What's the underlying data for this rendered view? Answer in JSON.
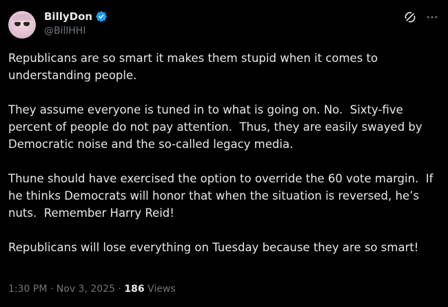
{
  "author": {
    "display_name": "BillyDon",
    "handle": "@BillHHI",
    "verified": true
  },
  "icons": {
    "verified": "verified-badge-icon",
    "grok": "grok-icon",
    "more": "more-options-icon"
  },
  "tweet": {
    "paragraphs": [
      "Republicans are so smart it makes them stupid when it comes to understanding people.",
      "They assume everyone is tuned in to what is going on. No.  Sixty-five percent of people do not pay attention.  Thus, they are easily swayed by Democratic noise and the so-called legacy media.",
      "Thune should have exercised the option to override the 60 vote margin.  If he thinks Democrats will honor that when the situation is reversed, he’s nuts.  Remember Harry Reid!",
      "Republicans will lose everything on Tuesday because they are so smart!"
    ]
  },
  "meta": {
    "time": "1:30 PM",
    "separator1": " · ",
    "date": "Nov 3, 2025",
    "separator2": " · ",
    "views_count": "186",
    "views_label": " Views"
  },
  "colors": {
    "background": "#000000",
    "text_primary": "#e7e9ea",
    "text_secondary": "#71767b",
    "verified_blue": "#1d9bf0"
  }
}
